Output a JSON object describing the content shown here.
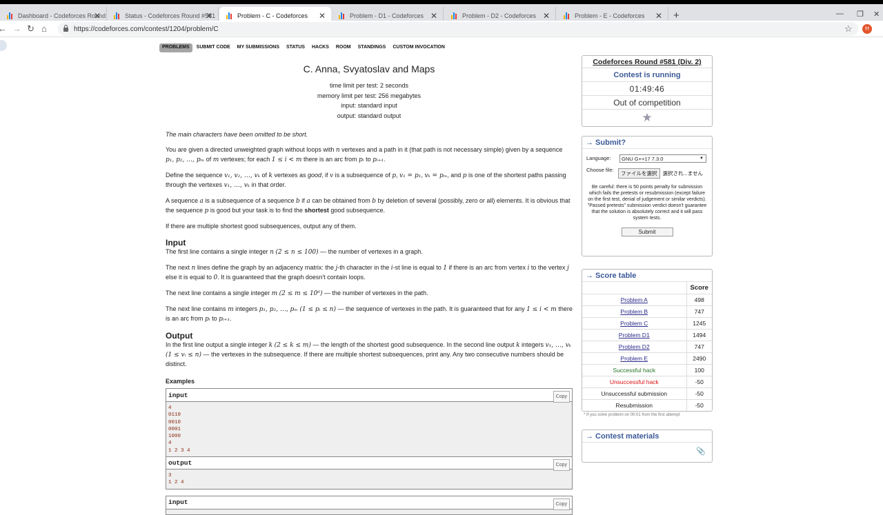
{
  "browser": {
    "tabs": [
      {
        "title": "Dashboard - Codeforces Round",
        "active": false
      },
      {
        "title": "Status - Codeforces Round #581",
        "active": false
      },
      {
        "title": "Problem - C - Codeforces",
        "active": true
      },
      {
        "title": "Problem - D1 - Codeforces",
        "active": false
      },
      {
        "title": "Problem - D2 - Codeforces",
        "active": false
      },
      {
        "title": "Problem - E - Codeforces",
        "active": false
      }
    ],
    "url": "https://codeforces.com/contest/1204/problem/C",
    "avatar_letter": "H"
  },
  "menu": [
    "PROBLEMS",
    "SUBMIT CODE",
    "MY SUBMISSIONS",
    "STATUS",
    "HACKS",
    "ROOM",
    "STANDINGS",
    "CUSTOM INVOCATION"
  ],
  "problem": {
    "title": "C. Anna, Svyatoslav and Maps",
    "time_limit": "time limit per test: 2 seconds",
    "memory_limit": "memory limit per test: 256 megabytes",
    "input": "input: standard input",
    "output": "output: standard output",
    "legend": "The main characters have been omitted to be short.",
    "p1a": "You are given a directed unweighted graph without loops with ",
    "p1b": " vertexes and a path in it (that path is not necessary simple) given by a sequence ",
    "p1c": " of ",
    "p1d": " vertexes; for each ",
    "p1e": " there is an arc from ",
    "p1f": " to ",
    "p2a": "Define the sequence ",
    "p2b": " of ",
    "p2c": " vertexes as ",
    "p2good": "good",
    "p2d": ", if ",
    "p2e": " is a subsequence of ",
    "p2f": ", ",
    "p2g": ", and ",
    "p2h": " is one of the shortest paths passing through the vertexes ",
    "p2i": " in that order.",
    "p3a": "A sequence ",
    "p3b": " is a subsequence of a sequence ",
    "p3c": " if ",
    "p3d": " can be obtained from ",
    "p3e": " by deletion of several (possibly, zero or all) elements. It is obvious that the sequence ",
    "p3f": " is good but your task is to find the ",
    "p3bold": "shortest",
    "p3g": " good subsequence.",
    "p4": "If there are multiple shortest good subsequences, output any of them.",
    "input_title": "Input",
    "in1a": "The first line contains a single integer ",
    "in1b": " — the number of vertexes in a graph.",
    "in2a": "The next ",
    "in2b": " lines define the graph by an adjacency matrix: the ",
    "in2c": "-th character in the ",
    "in2d": "-st line is equal to ",
    "in2e": " if there is an arc from vertex ",
    "in2f": " to the vertex ",
    "in2g": " else it is equal to ",
    "in2h": ". It is guaranteed that the graph doesn't contain loops.",
    "in3a": "The next line contains a single integer ",
    "in3b": " — the number of vertexes in the path.",
    "in4a": "The next line contains ",
    "in4b": " integers ",
    "in4c": " — the sequence of vertexes in the path. It is guaranteed that for any ",
    "in4d": " there is an arc from ",
    "in4e": " to ",
    "output_title": "Output",
    "out1a": "In the first line output a single integer ",
    "out1b": " — the length of the shortest good subsequence. In the second line output ",
    "out1c": " integers ",
    "out1d": " — the vertexes in the subsequence. If there are multiple shortest subsequences, print any. Any two consecutive numbers should be distinct.",
    "math": {
      "n": "n",
      "m": "m",
      "k": "k",
      "p": "p",
      "v": "v",
      "a": "a",
      "b": "b",
      "j": "j",
      "i": "i",
      "seq_p": "p₁, p₂, …, pₘ",
      "i_range": "1 ≤ i < m",
      "p_i": "pᵢ",
      "p_i1": "pᵢ₊₁",
      "seq_v": "v₁, v₂, …, vₖ",
      "v1p1": "v₁ = p₁",
      "vkpm": "vₖ = pₘ",
      "seq_v_short": "v₁, …, vₖ",
      "n_range": "(2 ≤ n ≤ 100)",
      "one": "1",
      "zero": "0",
      "m_range": "(2 ≤ m ≤ 10⁶)",
      "pi_range": "(1 ≤ pᵢ ≤ n)",
      "k_range": "(2 ≤ k ≤ m)",
      "vi_range": "(1 ≤ vᵢ ≤ n)"
    },
    "examples_title": "Examples",
    "samples": [
      {
        "label": "input",
        "copy": "Copy",
        "body": "4\n0110\n0010\n0001\n1000\n4\n1 2 3 4"
      },
      {
        "label": "output",
        "copy": "Copy",
        "body": "3\n1 2 4"
      },
      {
        "label": "input",
        "copy": "Copy",
        "body": ""
      }
    ]
  },
  "sidebar": {
    "round_title": "Codeforces Round #581 (Div. 2)",
    "status": "Contest is running",
    "timer": "01:49:46",
    "competition": "Out of competition",
    "submit_title": "→ Submit?",
    "language_label": "Language:",
    "language_value": "GNU G++17 7.3.0",
    "choose_file_label": "Choose file:",
    "file_button": "ファイルを選択",
    "file_status": "選択され...ません",
    "warning": "Be careful: there is 50 points penalty for submission which fails the pretests or resubmission (except failure on the first test, denial of judgement or similar verdicts). \"Passed pretests\" submission verdict doesn't guarantee that the solution is absolutely correct and it will pass system tests.",
    "submit_button": "Submit",
    "score_title": "→ Score table",
    "score_header": "Score",
    "score_rows": [
      {
        "name": "Problem A",
        "score": "498",
        "kind": "link"
      },
      {
        "name": "Problem B",
        "score": "747",
        "kind": "link"
      },
      {
        "name": "Problem C",
        "score": "1245",
        "kind": "link"
      },
      {
        "name": "Problem D1",
        "score": "1494",
        "kind": "link"
      },
      {
        "name": "Problem D2",
        "score": "747",
        "kind": "link"
      },
      {
        "name": "Problem E",
        "score": "2490",
        "kind": "link"
      },
      {
        "name": "Successful hack",
        "score": "100",
        "kind": "green"
      },
      {
        "name": "Unsuccessful hack",
        "score": "-50",
        "kind": "red"
      },
      {
        "name": "Unsuccessful submission",
        "score": "-50",
        "kind": "plain"
      },
      {
        "name": "Resubmission",
        "score": "-50",
        "kind": "plain"
      }
    ],
    "footnote": "* If you solve problem on 00:01 from the first attempt",
    "materials_title": "→ Contest materials"
  }
}
